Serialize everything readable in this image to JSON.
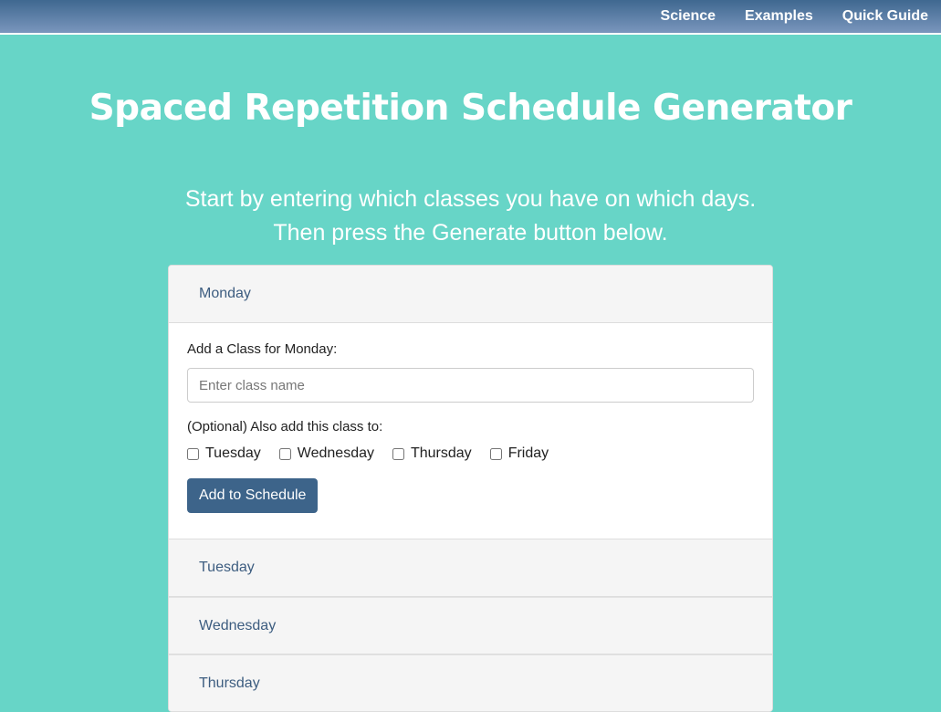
{
  "nav": {
    "links": [
      "Science",
      "Examples",
      "Quick Guide"
    ]
  },
  "title": "Spaced Repetition Schedule Generator",
  "intro": {
    "line1": "Start by entering which classes you have on which days.",
    "line2": "Then press the Generate button below."
  },
  "days": [
    "Monday",
    "Tuesday",
    "Wednesday",
    "Thursday"
  ],
  "monday_form": {
    "add_label": "Add a Class for Monday:",
    "input_value": "",
    "input_placeholder": "Enter class name",
    "optional_label": "(Optional) Also add this class to:",
    "checkboxes": [
      "Tuesday",
      "Wednesday",
      "Thursday",
      "Friday"
    ],
    "button_label": "Add to Schedule"
  },
  "colors": {
    "background": "#67d5c7",
    "navbar": "#5a7ea8",
    "button": "#3d648a",
    "day_header_text": "#3d5d80"
  }
}
